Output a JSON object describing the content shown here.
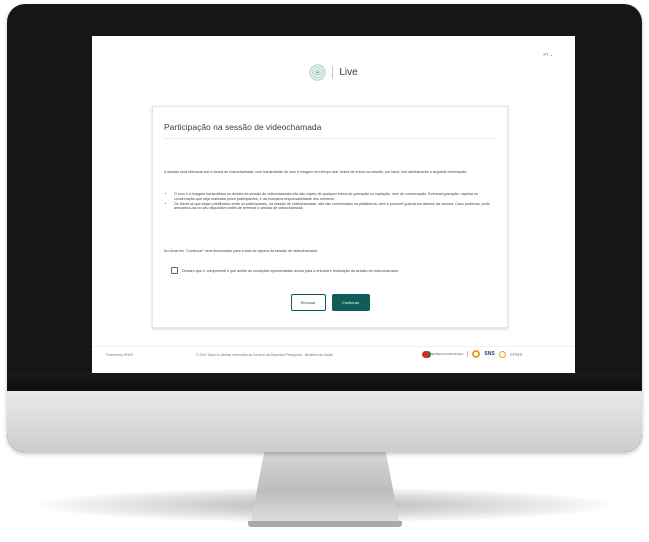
{
  "header": {
    "language": "PT ⌄",
    "app_name": "Live"
  },
  "card": {
    "title": "Participação na sessão de videochamada",
    "intro": "A sessão será efetuada sob a forma de videochamada, com transmissão de som e imagem em tempo real. Antes de entrar na sessão, por favor, leia atentamente a seguinte informação:",
    "bullets": [
      "O som e a imagem transmitidos no âmbito da sessão de videochamada não são objeto de qualquer forma de gravação ou captação, nem de conservação. Eventual gravação, captura ou conservação que seja realizada pelos participantes, é da exclusiva responsabilidade dos mesmos;",
      "Os ficheiros que sejam partilhados entre os participantes, na sessão de videochamada, não são conservados na plataforma, nem é possível guardá-los através da mesma. Caso pretenda, pode armazená-los no seu dispositivo antes de terminar a sessão de videochamada;"
    ],
    "continue_note": "Ao clicar em \"Continuar\" será direcionado para a sala de espera da sessão de videochamada.",
    "consent_label": "Declaro que li, compreendi e que aceito as condições apresentadas acima para a entrada e realização da sessão de videochamada.",
    "consent_checked": false,
    "buttons": {
      "decline": "Recusar",
      "continue": "Continuar"
    }
  },
  "footer": {
    "powered_by": "Powered by SPMS",
    "copyright": "© 2024 Todos os direitos reservados ao Governo da República Portuguesa - Ministério da Saúde",
    "logos": {
      "republic": "REPÚBLICA PORTUGUESA",
      "sns": "SNS",
      "spms": "SPMS"
    }
  },
  "colors": {
    "accent": "#0f5c59",
    "monitor_frame": "#161616",
    "chin": "#d4d4d4"
  }
}
